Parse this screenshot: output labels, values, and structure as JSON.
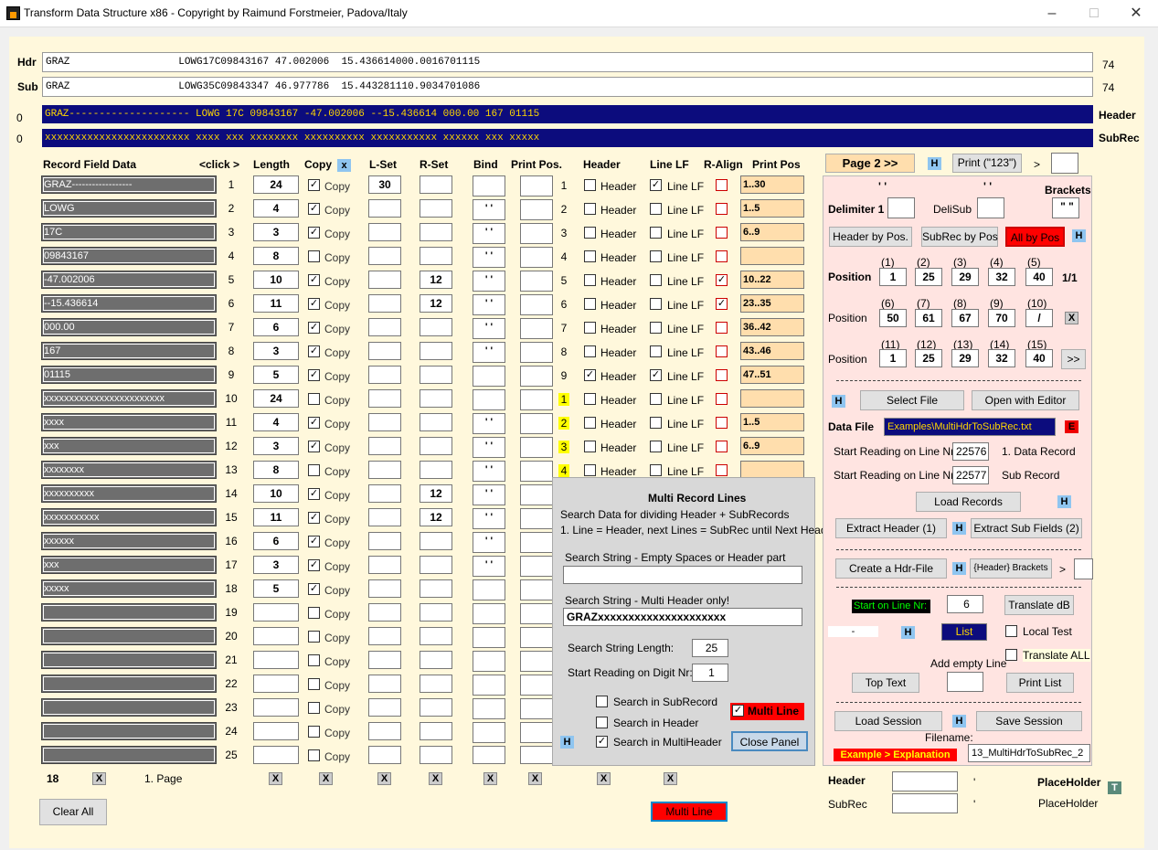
{
  "window": {
    "title": "Transform Data Structure   x86 - Copyright by Raimund Forstmeier, Padova/Italy"
  },
  "hdr": {
    "label": "Hdr",
    "text": "GRAZ                  LOWG17C09843167 47.002006  15.436614000.0016701115",
    "len": "74"
  },
  "sub": {
    "label": "Sub",
    "text": "GRAZ                  LOWG35C09843347 46.977786  15.443281110.9034701086",
    "len": "74"
  },
  "line0a": "0",
  "line0b": "0",
  "header_line": "GRAZ-------------------- LOWG 17C 09843167 -47.002006 --15.436614 000.00 167 01115",
  "header_label": "Header",
  "subrec_line": "xxxxxxxxxxxxxxxxxxxxxxxx xxxx xxx xxxxxxxx xxxxxxxxxx xxxxxxxxxxx xxxxxx xxx xxxxx",
  "subrec_label": "SubRec",
  "cols": {
    "field": "Record Field Data",
    "click": "<click >",
    "length": "Length",
    "copy": "Copy",
    "lset": "L-Set",
    "rset": "R-Set",
    "bind": "Bind",
    "printpos": "Print Pos.",
    "header": "Header",
    "linelf": "Line LF",
    "ralign": "R-Align",
    "printpos2": "Print Pos",
    "copyx": "x"
  },
  "rows": [
    {
      "n": "1",
      "data": "GRAZ------------------",
      "len": "24",
      "copy": true,
      "lset": "30",
      "rset": "",
      "bind": "",
      "pn": "1",
      "yel": false,
      "hdr": false,
      "lf": true,
      "ra": false,
      "pp": "1..30",
      "ppc": true
    },
    {
      "n": "2",
      "data": "LOWG",
      "len": "4",
      "copy": true,
      "lset": "",
      "rset": "",
      "bind": "' '",
      "pn": "2",
      "yel": false,
      "hdr": false,
      "lf": false,
      "ra": false,
      "pp": "1..5",
      "ppc": true
    },
    {
      "n": "3",
      "data": "17C",
      "len": "3",
      "copy": true,
      "lset": "",
      "rset": "",
      "bind": "' '",
      "pn": "3",
      "yel": false,
      "hdr": false,
      "lf": false,
      "ra": false,
      "pp": "6..9",
      "ppc": true
    },
    {
      "n": "4",
      "data": "09843167",
      "len": "8",
      "copy": false,
      "lset": "",
      "rset": "",
      "bind": "' '",
      "pn": "4",
      "yel": false,
      "hdr": false,
      "lf": false,
      "ra": false,
      "pp": "",
      "ppc": true
    },
    {
      "n": "5",
      "data": "-47.002006",
      "len": "10",
      "copy": true,
      "lset": "",
      "rset": "12",
      "bind": "' '",
      "pn": "5",
      "yel": false,
      "hdr": false,
      "lf": false,
      "ra": true,
      "pp": "10..22",
      "ppc": true
    },
    {
      "n": "6",
      "data": "--15.436614",
      "len": "11",
      "copy": true,
      "lset": "",
      "rset": "12",
      "bind": "' '",
      "pn": "6",
      "yel": false,
      "hdr": false,
      "lf": false,
      "ra": true,
      "pp": "23..35",
      "ppc": true
    },
    {
      "n": "7",
      "data": "000.00",
      "len": "6",
      "copy": true,
      "lset": "",
      "rset": "",
      "bind": "' '",
      "pn": "7",
      "yel": false,
      "hdr": false,
      "lf": false,
      "ra": false,
      "pp": "36..42",
      "ppc": true
    },
    {
      "n": "8",
      "data": "167",
      "len": "3",
      "copy": true,
      "lset": "",
      "rset": "",
      "bind": "' '",
      "pn": "8",
      "yel": false,
      "hdr": false,
      "lf": false,
      "ra": false,
      "pp": "43..46",
      "ppc": true
    },
    {
      "n": "9",
      "data": "01115",
      "len": "5",
      "copy": true,
      "lset": "",
      "rset": "",
      "bind": "",
      "pn": "9",
      "yel": false,
      "hdr": true,
      "lf": true,
      "ra": false,
      "pp": "47..51",
      "ppc": true
    },
    {
      "n": "10",
      "data": "xxxxxxxxxxxxxxxxxxxxxxxx",
      "len": "24",
      "copy": false,
      "lset": "",
      "rset": "",
      "bind": "",
      "pn": "1",
      "yel": true,
      "hdr": false,
      "lf": false,
      "ra": false,
      "pp": "",
      "ppc": true
    },
    {
      "n": "11",
      "data": "xxxx",
      "len": "4",
      "copy": true,
      "lset": "",
      "rset": "",
      "bind": "' '",
      "pn": "2",
      "yel": true,
      "hdr": false,
      "lf": false,
      "ra": false,
      "pp": "1..5",
      "ppc": true
    },
    {
      "n": "12",
      "data": "xxx",
      "len": "3",
      "copy": true,
      "lset": "",
      "rset": "",
      "bind": "' '",
      "pn": "3",
      "yel": true,
      "hdr": false,
      "lf": false,
      "ra": false,
      "pp": "6..9",
      "ppc": true
    },
    {
      "n": "13",
      "data": "xxxxxxxx",
      "len": "8",
      "copy": false,
      "lset": "",
      "rset": "",
      "bind": "' '",
      "pn": "4",
      "yel": true,
      "hdr": false,
      "lf": false,
      "ra": false,
      "pp": "",
      "ppc": true
    },
    {
      "n": "14",
      "data": "xxxxxxxxxx",
      "len": "10",
      "copy": true,
      "lset": "",
      "rset": "12",
      "bind": "' '",
      "pn": "",
      "yel": false,
      "hdr": false,
      "lf": false,
      "ra": false,
      "pp": "",
      "ppc": false
    },
    {
      "n": "15",
      "data": "xxxxxxxxxxx",
      "len": "11",
      "copy": true,
      "lset": "",
      "rset": "12",
      "bind": "' '",
      "pn": "",
      "yel": false,
      "hdr": false,
      "lf": false,
      "ra": false,
      "pp": "",
      "ppc": false
    },
    {
      "n": "16",
      "data": "xxxxxx",
      "len": "6",
      "copy": true,
      "lset": "",
      "rset": "",
      "bind": "' '",
      "pn": "",
      "yel": false,
      "hdr": false,
      "lf": false,
      "ra": false,
      "pp": "",
      "ppc": false
    },
    {
      "n": "17",
      "data": "xxx",
      "len": "3",
      "copy": true,
      "lset": "",
      "rset": "",
      "bind": "' '",
      "pn": "",
      "yel": false,
      "hdr": false,
      "lf": false,
      "ra": false,
      "pp": "",
      "ppc": false
    },
    {
      "n": "18",
      "data": "xxxxx",
      "len": "5",
      "copy": true,
      "lset": "",
      "rset": "",
      "bind": "",
      "pn": "",
      "yel": false,
      "hdr": false,
      "lf": false,
      "ra": false,
      "pp": "",
      "ppc": false
    },
    {
      "n": "19",
      "data": "",
      "len": "",
      "copy": false,
      "lset": "",
      "rset": "",
      "bind": "",
      "pn": "",
      "yel": false,
      "hdr": false,
      "lf": false,
      "ra": false,
      "pp": "",
      "ppc": false
    },
    {
      "n": "20",
      "data": "",
      "len": "",
      "copy": false,
      "lset": "",
      "rset": "",
      "bind": "",
      "pn": "",
      "yel": false,
      "hdr": false,
      "lf": false,
      "ra": false,
      "pp": "",
      "ppc": false
    },
    {
      "n": "21",
      "data": "",
      "len": "",
      "copy": false,
      "lset": "",
      "rset": "",
      "bind": "",
      "pn": "",
      "yel": false,
      "hdr": false,
      "lf": false,
      "ra": false,
      "pp": "",
      "ppc": false
    },
    {
      "n": "22",
      "data": "",
      "len": "",
      "copy": false,
      "lset": "",
      "rset": "",
      "bind": "",
      "pn": "",
      "yel": false,
      "hdr": false,
      "lf": false,
      "ra": false,
      "pp": "",
      "ppc": false
    },
    {
      "n": "23",
      "data": "",
      "len": "",
      "copy": false,
      "lset": "",
      "rset": "",
      "bind": "",
      "pn": "",
      "yel": false,
      "hdr": false,
      "lf": false,
      "ra": false,
      "pp": "",
      "ppc": false
    },
    {
      "n": "24",
      "data": "",
      "len": "",
      "copy": false,
      "lset": "",
      "rset": "",
      "bind": "",
      "pn": "",
      "yel": false,
      "hdr": false,
      "lf": false,
      "ra": false,
      "pp": "",
      "ppc": false
    },
    {
      "n": "25",
      "data": "",
      "len": "",
      "copy": false,
      "lset": "",
      "rset": "",
      "bind": "",
      "pn": "",
      "yel": false,
      "hdr": false,
      "lf": false,
      "ra": false,
      "pp": "",
      "ppc": false
    }
  ],
  "labels": {
    "copy": "Copy",
    "header": "Header",
    "linelf": "Line LF"
  },
  "footer": {
    "count": "18",
    "page": "1. Page",
    "clear_all": "Clear All",
    "multi_line": "Multi Line",
    "x": "X"
  },
  "panel": {
    "title": "Multi Record Lines",
    "desc1": "Search Data for dividing Header + SubRecords",
    "desc2": "1. Line = Header, next Lines = SubRec until Next Header",
    "search_empty_label": "Search String - Empty Spaces or Header part",
    "search_empty": "",
    "search_multi_label": "Search String - Multi Header only!",
    "search_multi": "GRAZxxxxxxxxxxxxxxxxxxxxx",
    "length_label": "Search String Length:",
    "length": "25",
    "start_label": "Start Reading on Digit Nr:",
    "start": "1",
    "opt_sub": "Search in SubRecord",
    "opt_hdr": "Search in Header",
    "opt_multi": "Search in MultiHeader",
    "multi_line": "Multi Line",
    "close": "Close Panel",
    "h": "H"
  },
  "right": {
    "page2": "Page 2 >>",
    "h": "H",
    "print": "Print (\"123\")",
    "gt": ">",
    "quote1": "'   '",
    "quote2": "'   '",
    "brackets": "Brackets",
    "delim": "Delimiter 1",
    "delisub": "DeliSub",
    "bracket_val": "\" \"",
    "hdr_pos": "Header by Pos.",
    "subrec_pos": "SubRec by Pos",
    "all_pos": "All by Pos",
    "position": "Position",
    "pos_small": "Position",
    "ratio": "1/1",
    "x": "X",
    "more": ">>",
    "p1_labels": [
      "(1)",
      "(2)",
      "(3)",
      "(4)",
      "(5)"
    ],
    "p1_vals": [
      "1",
      "25",
      "29",
      "32",
      "40"
    ],
    "p2_labels": [
      "(6)",
      "(7)",
      "(8)",
      "(9)",
      "(10)"
    ],
    "p2_vals": [
      "50",
      "61",
      "67",
      "70",
      "/"
    ],
    "p3_labels": [
      "(11)",
      "(12)",
      "(13)",
      "(14)",
      "(15)"
    ],
    "p3_vals": [
      "1",
      "25",
      "29",
      "32",
      "40"
    ],
    "select_file": "Select File",
    "open_editor": "Open with Editor",
    "data_file": "Data File",
    "file_path": "Examples\\MultiHdrToSubRec.txt",
    "e": "E",
    "start_line": "Start Reading on Line Nr:",
    "start1": "22576",
    "start1_label": "1.  Data Record",
    "start2": "22577",
    "start2_label": "Sub Record",
    "load_records": "Load Records",
    "extract_hdr": "Extract Header  (1)",
    "extract_sub": "Extract Sub Fields (2)",
    "create_hdr": "Create a Hdr-File",
    "hdr_brackets": "{Header} Brackets",
    "start_on_line": "Start on Line Nr:",
    "start_on_val": "6",
    "translate": "Translate dB",
    "dash": "-",
    "list": "List",
    "local_test": "Local Test",
    "add_empty": "Add empty Line",
    "translate_all": "Translate ALL",
    "top_text": "Top Text",
    "print_list": "Print List",
    "load_session": "Load Session",
    "save_session": "Save Session",
    "filename": "Filename:",
    "example": "Example > Explanation",
    "filename_val": "13_MultiHdrToSubRec_2"
  },
  "bottom": {
    "header": "Header",
    "subrec": "SubRec",
    "apos": "'",
    "placeholder": "PlaceHolder",
    "placeholder2": "PlaceHolder",
    "t": "T"
  }
}
